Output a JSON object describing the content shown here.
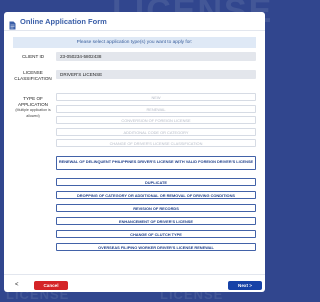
{
  "background": {
    "watermark_top": "LICENSE",
    "watermark_bottom_left": "LICENSE",
    "watermark_bottom_right": "LICENSE"
  },
  "modal": {
    "title": "Online Application Form",
    "icon": "document-icon"
  },
  "banner": "Please select application type(s) you want to apply for:",
  "client": {
    "label": "CLIENT ID",
    "value": "23-050234-5802438"
  },
  "license": {
    "label": "LICENSE CLASSIFICATION",
    "value": "DRIVER'S LICENSE"
  },
  "type": {
    "label": "TYPE OF APPLICATION",
    "hint": "(Multiple application is allowed)"
  },
  "options": [
    {
      "label": "NEW",
      "enabled": false
    },
    {
      "label": "RENEWAL",
      "enabled": false
    },
    {
      "label": "CONVERSION OF FOREIGN LICENSE",
      "enabled": false
    },
    {
      "label": "ADDITIONAL CODE OR CATEGORY",
      "enabled": false
    },
    {
      "label": "CHANGE OF DRIVER'S LICENSE CLASSIFICATION",
      "enabled": false
    },
    {
      "label": "RENEWAL OF DELINQUENT PHILIPPINES DRIVER'S LICENSE WITH VALID FOREIGN DRIVER'S LICENSE",
      "enabled": true
    },
    {
      "label": "DUPLICATE",
      "enabled": true
    },
    {
      "label": "DROPPING OF CATEGORY OR ADDITIONAL OR REMOVAL OF DRIVING CONDITIONS",
      "enabled": true
    },
    {
      "label": "REVISION OF RECORDS",
      "enabled": true
    },
    {
      "label": "ENHANCEMENT OF DRIVER'S LICENSE",
      "enabled": true
    },
    {
      "label": "CHANGE OF CLUTCH TYPE",
      "enabled": true
    },
    {
      "label": "OVERSEAS FILIPINO WORKER DRIVER'S LICENSE RENEWAL",
      "enabled": true
    }
  ],
  "footer": {
    "back_icon": "chevron-left-icon",
    "back_symbol": "<",
    "cancel": "Cancel",
    "next": "Next >"
  },
  "colors": {
    "accent": "#1742a7",
    "danger": "#d42427",
    "banner_bg": "#dfe9f6",
    "page_bg": "#31468e"
  }
}
